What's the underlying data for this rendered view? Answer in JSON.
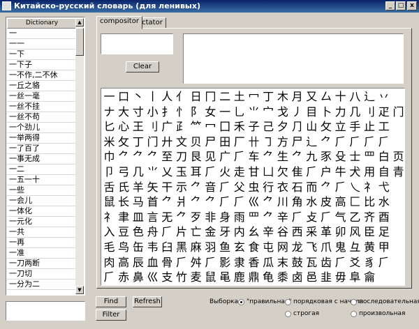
{
  "window": {
    "title": "Китайско-русский словарь (для ленивых)",
    "minimize_glyph": "_",
    "maximize_glyph": "□",
    "close_glyph": "x",
    "icon": "app-window-icon"
  },
  "dictionary": {
    "header": "Dictionary",
    "items": [
      "一",
      "一一",
      "一下",
      "一下子",
      "一不作,二不休",
      "一丘之貉",
      "一丝一毫",
      "一丝不挂",
      "一丝不苟",
      "一个劲儿",
      "一举两得",
      "一了百了",
      "一事无成",
      "一二",
      "一五一十",
      "一些",
      "一会儿",
      "一体化",
      "一元化",
      "一共",
      "一再",
      "一准",
      "一刀两断",
      "一刀切",
      "一分为二"
    ],
    "scroll_up": "▲",
    "scroll_down": "▼"
  },
  "search": {
    "value": ""
  },
  "tabs": [
    {
      "label": "compositor",
      "active": true
    },
    {
      "label": "dictator",
      "active": false
    }
  ],
  "compositor": {
    "input_value": "",
    "clear_label": "Clear",
    "result_value": ""
  },
  "radicals": [
    [
      "一",
      "口",
      "丶",
      "丨",
      "人",
      "亻",
      "日",
      "冂",
      "二",
      "土",
      "冖",
      "丁",
      "木",
      "月",
      "又",
      "厶",
      "十",
      "八",
      "辶",
      "丷"
    ],
    [
      "ナ",
      "大",
      "寸",
      "小",
      "扌",
      "忄",
      "阝",
      "女",
      "一",
      "乚",
      "⺌",
      "宀",
      "戈",
      "丿",
      "目",
      "卜",
      "力",
      "几",
      "刂",
      "疋",
      "门"
    ],
    [
      "匕",
      "心",
      "王",
      "刂",
      "广",
      "⺪",
      "⺮",
      "冖",
      "囗",
      "禾",
      "子",
      "己",
      "夕",
      "⺆",
      "山",
      "攵",
      "立",
      "手",
      "止",
      "工"
    ],
    [
      "米",
      "攵",
      "丁",
      "门",
      "廾",
      "文",
      "贝",
      "尸",
      "田",
      "厂",
      "卄",
      "㇆",
      "方",
      "尸",
      "⻌",
      "⺈",
      "⺁",
      "⺁",
      "⺁",
      "⺁"
    ],
    [
      "巾",
      "⺈",
      "⺈",
      "⺈",
      "至",
      "刀",
      "艮",
      "见",
      "广",
      "⺁",
      "车",
      "⺈",
      "生",
      "⺈",
      "九",
      "豕",
      "殳",
      "士",
      "罒",
      "白",
      "页"
    ],
    [
      "卩",
      "弓",
      "几",
      "⺌",
      "乂",
      "玉",
      "耳",
      "⺁",
      "火",
      "走",
      "甘",
      "凵",
      "欠",
      "隹",
      "⺁",
      "户",
      "牛",
      "犬",
      "用",
      "自",
      "青"
    ],
    [
      "舌",
      "氏",
      "羊",
      "矢",
      "干",
      "示",
      "⺈",
      "音",
      "⺁",
      "父",
      "虫",
      "行",
      "衣",
      "石",
      "而",
      "⺈",
      "⺁",
      "乀",
      "礻",
      "弋"
    ],
    [
      "鼠",
      "长",
      "马",
      "首",
      "⺈",
      "爿",
      "⺈",
      "⺈",
      "⺁",
      "⺁",
      "巛",
      "⺈",
      "川",
      "角",
      "水",
      "皮",
      "高",
      "匚",
      "比",
      "水"
    ],
    [
      "礻",
      "聿",
      "皿",
      "言",
      "无",
      "⺈",
      "歹",
      "非",
      "身",
      "雨",
      "罒",
      "⺈",
      "辛",
      "⺁",
      "攴",
      "⺁",
      "气",
      "乙",
      "齐",
      "酉"
    ],
    [
      "入",
      "豆",
      "色",
      "舟",
      "⺁",
      "片",
      "亡",
      "金",
      "牙",
      "内",
      "幺",
      "辛",
      "谷",
      "西",
      "采",
      "革",
      "卯",
      "风",
      "臣",
      "足"
    ],
    [
      "毛",
      "鸟",
      "缶",
      "韦",
      "臼",
      "黑",
      "麻",
      "羽",
      "鱼",
      "玄",
      "食",
      "屯",
      "网",
      "龙",
      "飞",
      "爪",
      "鬼",
      "彑",
      "黄",
      "甲"
    ],
    [
      "肉",
      "高",
      "辰",
      "血",
      "骨",
      "⺁",
      "舛",
      "⺁",
      "影",
      "隶",
      "香",
      "瓜",
      "末",
      "鼓",
      "瓦",
      "齿",
      "⺁",
      "爻",
      "豸",
      "⺁"
    ],
    [
      "⺁",
      "赤",
      "鼻",
      "巛",
      "支",
      "竹",
      "麦",
      "鼠",
      "黾",
      "鹿",
      "鼎",
      "龟",
      "黍",
      "卤",
      "邑",
      "韭",
      "毋",
      "阜",
      "龠"
    ]
  ],
  "actions": {
    "find_label": "Find",
    "refresh_label": "Refresh",
    "filter_label": "Filter"
  },
  "selection": {
    "label": "Выборка:",
    "options": [
      {
        "label": "\"правильная\"",
        "checked": true
      },
      {
        "label": "порядковая с начала",
        "checked": false
      },
      {
        "label": "последовательная",
        "checked": false
      },
      {
        "label": "строгая",
        "checked": false
      },
      {
        "label": "произвольная",
        "checked": false
      }
    ]
  },
  "colors": {
    "titlebar_start": "#0a246a",
    "titlebar_end": "#3a6ea5",
    "window_bg": "#d4d0c8",
    "field_bg": "#ffffff"
  }
}
